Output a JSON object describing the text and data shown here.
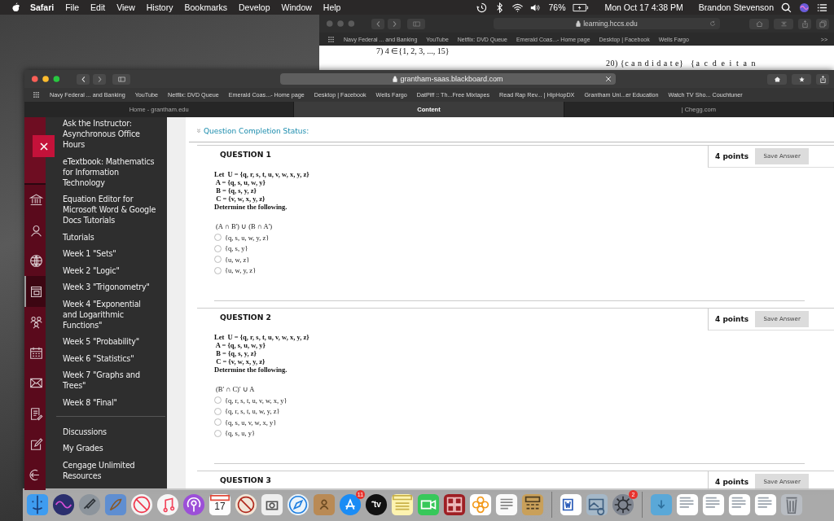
{
  "menu_bar": {
    "app_name": "Safari",
    "menus": [
      "File",
      "Edit",
      "View",
      "History",
      "Bookmarks",
      "Develop",
      "Window",
      "Help"
    ],
    "battery": "76%",
    "clock": "Mon Oct 17  4:38 PM",
    "user": "Brandon Stevenson"
  },
  "back_window": {
    "address": "learning.hccs.edu",
    "bookmarks": [
      "Navy Federal ... and Banking",
      "YouTube",
      "Netflix: DVD Queue",
      "Emerald Coas...- Home page",
      "Desktop | Facebook",
      "Wells Fargo"
    ],
    "overflow": ">>",
    "content_lines": [
      "7) 4 ∈{1, 2, 3, ..., 15}",
      "20) {c a n d i d a t e}",
      "{a c d e i t a n"
    ]
  },
  "front_window": {
    "address": "grantham-saas.blackboard.com",
    "bookmarks": [
      "Navy Federal ... and Banking",
      "YouTube",
      "Netflix: DVD Queue",
      "Emerald Coas...- Home page",
      "Desktop | Facebook",
      "Wells Fargo",
      "DatPiff :: Th...Free Mixtapes",
      "Read Rap Rev... | HipHopDX",
      "Grantham Uni...er Education",
      "Watch TV Sho... Couchtuner"
    ],
    "tabs": [
      {
        "label": "Home - grantham.edu",
        "selected": false
      },
      {
        "label": "Content",
        "selected": true
      },
      {
        "label": "| Chegg.com",
        "selected": false
      }
    ]
  },
  "course_rail": [
    {
      "kind": "institution",
      "selected": false
    },
    {
      "kind": "person",
      "selected": false
    },
    {
      "kind": "globe",
      "selected": false
    },
    {
      "kind": "content",
      "selected": true
    },
    {
      "kind": "groups",
      "selected": false
    },
    {
      "kind": "calendar",
      "selected": false
    },
    {
      "kind": "mail",
      "selected": false
    },
    {
      "kind": "document",
      "selected": false
    },
    {
      "kind": "edit",
      "selected": false
    },
    {
      "kind": "sign-out",
      "selected": false
    }
  ],
  "course_menu": {
    "items": [
      "Ask the Instructor: Asynchronous Office Hours",
      "eTextbook: Mathematics for Information Technology",
      "Equation Editor for Microsoft Word & Google Docs Tutorials",
      "Tutorials",
      "Week 1 \"Sets\"",
      "Week 2 \"Logic\"",
      "Week 3 \"Trigonometry\"",
      "Week 4 \"Exponential and Logarithmic Functions\"",
      "Week 5 \"Probability\"",
      "Week 6 \"Statistics\"",
      "Week 7 \"Graphs and Trees\"",
      "Week 8 \"Final\""
    ],
    "secondary_items": [
      "Discussions",
      "My Grades",
      "Cengage Unlimited Resources"
    ]
  },
  "test": {
    "completion_status": "Question Completion Status:",
    "questions": [
      {
        "label": "QUESTION 1",
        "points": "4 points",
        "save": "Save Answer",
        "prompt": [
          "Let  U = {q, r, s, t, u, v, w, x, y, z}",
          " A = {q, s, u, w, y}",
          " B = {q, s, y, z}",
          " C = {v, w, x, y, z}",
          "Determine the following."
        ],
        "expression": "(A ∩ B') ∪ (B ∩ A')",
        "options": [
          {
            "text": "{q, s, u, w, y, z}",
            "selected": false
          },
          {
            "text": "{q, s, y}",
            "selected": false
          },
          {
            "text": "{u, w, z}",
            "selected": false
          },
          {
            "text": "{u, w, y, z}",
            "selected": false
          }
        ]
      },
      {
        "label": "QUESTION 2",
        "points": "4 points",
        "save": "Save Answer",
        "prompt": [
          "Let  U = {q, r, s, t, u, v, w, x, y, z}",
          " A = {q, s, u, w, y}",
          " B = {q, s, y, z}",
          " C = {v, w, x, y, z}",
          "Determine the following."
        ],
        "expression": "(B' ∩ C)' ∪ A",
        "options": [
          {
            "text": "{q, r, s, t, u, v, w, x, y}",
            "selected": false
          },
          {
            "text": "{q, r, s, t, u, w, y, z}",
            "selected": false
          },
          {
            "text": "{q, s, u, v, w, x, y}",
            "selected": false
          },
          {
            "text": "{q, s, u, y}",
            "selected": false
          }
        ]
      },
      {
        "label": "QUESTION 3",
        "points": "4 points",
        "save": "Save Answer"
      }
    ]
  },
  "dock": {
    "calendar_date": "17",
    "tv_label": "tv",
    "app_store_badge": "11",
    "settings_badge": "2"
  }
}
